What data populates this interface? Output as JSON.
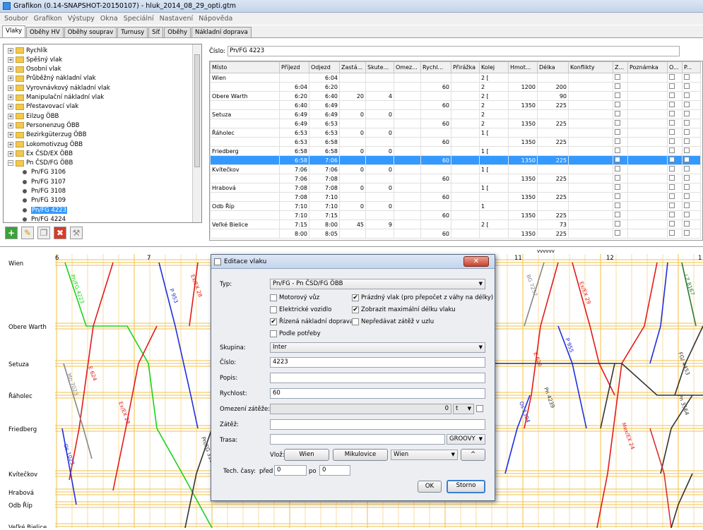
{
  "window": {
    "title": "Grafikon (0.14-SNAPSHOT-20150107) - hluk_2014_08_29_opti.gtm"
  },
  "menu": [
    "Soubor",
    "Grafikon",
    "Výstupy",
    "Okna",
    "Speciální",
    "Nastavení",
    "Nápověda"
  ],
  "tabs": [
    "Vlaky",
    "Oběhy HV",
    "Oběhy souprav",
    "Turnusy",
    "Síť",
    "Oběhy",
    "Nákladní doprava"
  ],
  "tree": {
    "categories": [
      "Rychlík",
      "Spěšný vlak",
      "Osobní vlak",
      "Průběžný nákladní vlak",
      "Vyrovnávkový nákladní vlak",
      "Manipulační nákladní vlak",
      "Přestavovací vlak",
      "Eilzug ÖBB",
      "Personenzug ÖBB",
      "Bezirkgüterzug ÖBB",
      "Lokomotivzug ÖBB",
      "Ex ČSD/EX ÖBB",
      "Pn ČSD/FG ÖBB"
    ],
    "trains": [
      "Pn/FG 3106",
      "Pn/FG 3107",
      "Pn/FG 3108",
      "Pn/FG 3109",
      "Pn/FG 4223",
      "Pn/FG 4224"
    ],
    "expanded": [
      "−",
      "−"
    ],
    "collapsed": "+"
  },
  "toolbar_icons": [
    "add-icon",
    "edit-icon",
    "copy-icon",
    "delete-icon",
    "tools-icon"
  ],
  "train_number": {
    "label": "Číslo:",
    "value": "Pn/FG 4223"
  },
  "route_table": {
    "columns": [
      "Místo",
      "Příjezd",
      "Odjezd",
      "Zastá...",
      "Skute...",
      "Omez...",
      "Rychl...",
      "Přirážka",
      "Kolej",
      "Hmot...",
      "Délka",
      "Konflikty",
      "Z...",
      "Poznámka",
      "O...",
      "P..."
    ],
    "rows": [
      [
        "Wien",
        "",
        "6:04",
        "",
        "",
        "",
        "",
        "",
        "2 [",
        "",
        "",
        "",
        "",
        "",
        "",
        ""
      ],
      [
        "",
        "6:04",
        "6:20",
        "",
        "",
        "",
        "60",
        "",
        "2",
        "1200",
        "200",
        "",
        "",
        "",
        "",
        ""
      ],
      [
        "Obere Warth",
        "6:20",
        "6:40",
        "20",
        "4",
        "",
        "",
        "",
        "2 [",
        "",
        "90",
        "",
        "",
        "",
        "",
        ""
      ],
      [
        "",
        "6:40",
        "6:49",
        "",
        "",
        "",
        "60",
        "",
        "2",
        "1350",
        "225",
        "",
        "",
        "",
        "",
        ""
      ],
      [
        "Setuza",
        "6:49",
        "6:49",
        "0",
        "0",
        "",
        "",
        "",
        "2",
        "",
        "",
        "",
        "",
        "",
        "",
        ""
      ],
      [
        "",
        "6:49",
        "6:53",
        "",
        "",
        "",
        "60",
        "",
        "2",
        "1350",
        "225",
        "",
        "",
        "",
        "",
        ""
      ],
      [
        "Řáholec",
        "6:53",
        "6:53",
        "0",
        "0",
        "",
        "",
        "",
        "1 [",
        "",
        "",
        "",
        "",
        "",
        "",
        ""
      ],
      [
        "",
        "6:53",
        "6:58",
        "",
        "",
        "",
        "60",
        "",
        "",
        "1350",
        "225",
        "",
        "",
        "",
        "",
        ""
      ],
      [
        "Friedberg",
        "6:58",
        "6:58",
        "0",
        "0",
        "",
        "",
        "",
        "1 [",
        "",
        "",
        "",
        "",
        "",
        "",
        ""
      ],
      [
        "",
        "6:58",
        "7:06",
        "",
        "",
        "",
        "60",
        "",
        "",
        "1350",
        "225",
        "",
        "",
        "",
        "",
        ""
      ],
      [
        "Kvítečkov",
        "7:06",
        "7:06",
        "0",
        "0",
        "",
        "",
        "",
        "1 [",
        "",
        "",
        "",
        "",
        "",
        "",
        ""
      ],
      [
        "",
        "7:06",
        "7:08",
        "",
        "",
        "",
        "60",
        "",
        "",
        "1350",
        "225",
        "",
        "",
        "",
        "",
        ""
      ],
      [
        "Hrabová",
        "7:08",
        "7:08",
        "0",
        "0",
        "",
        "",
        "",
        "1 [",
        "",
        "",
        "",
        "",
        "",
        "",
        ""
      ],
      [
        "",
        "7:08",
        "7:10",
        "",
        "",
        "",
        "60",
        "",
        "",
        "1350",
        "225",
        "",
        "",
        "",
        "",
        ""
      ],
      [
        "Odb Říp",
        "7:10",
        "7:10",
        "0",
        "0",
        "",
        "",
        "",
        "1",
        "",
        "",
        "",
        "",
        "",
        "",
        ""
      ],
      [
        "",
        "7:10",
        "7:15",
        "",
        "",
        "",
        "60",
        "",
        "",
        "1350",
        "225",
        "",
        "",
        "",
        "",
        ""
      ],
      [
        "Veľké Bielice",
        "7:15",
        "8:00",
        "45",
        "9",
        "",
        "",
        "",
        "2 [",
        "",
        "73",
        "",
        "",
        "",
        "",
        ""
      ],
      [
        "",
        "8:00",
        "8:05",
        "",
        "",
        "",
        "60",
        "",
        "",
        "1350",
        "225",
        "",
        "",
        "",
        "",
        ""
      ]
    ]
  },
  "graph": {
    "stations": [
      "Wien",
      "Obere Warth",
      "Setuza",
      "Řáholec",
      "Friedberg",
      "Kvítečkov",
      "Hrabová",
      "Odb Říp",
      "Veľké Bielice"
    ],
    "hours": [
      "6",
      "7",
      "11",
      "12",
      "1"
    ],
    "marker": "vvvvvv",
    "train_labels": [
      "Pn/FG 4223",
      "E 624",
      "Ex/EX 28",
      "P 953",
      "Mn 7023",
      "Os 1023",
      "Pn/FG 3106",
      "Os 1304",
      "BG 7252",
      "E 626",
      "Ex/EX 29",
      "Mex/EX 24",
      "P 955",
      "Pn 4239",
      "Pn 4184",
      "Pn 3564",
      "FG/ 4453",
      "LZ 8167"
    ]
  },
  "dialog": {
    "title": "Editace vlaku",
    "typ_label": "Typ:",
    "typ_value": "Pn/FG - Pn ČSD/FG ÖBB",
    "checkboxes_left": [
      {
        "label": "Motorový vůz",
        "checked": false
      },
      {
        "label": "Elektrické vozidlo",
        "checked": false
      },
      {
        "label": "Řízená nákladní doprava",
        "checked": true
      },
      {
        "label": "Podle potřeby",
        "checked": false
      }
    ],
    "checkboxes_right": [
      {
        "label": "Prázdný vlak (pro přepočet z váhy na délky)",
        "checked": true
      },
      {
        "label": "Zobrazit maximální délku vlaku",
        "checked": true
      },
      {
        "label": "Nepředávat zátěž v uzlu",
        "checked": false
      }
    ],
    "skupina_label": "Skupina:",
    "skupina_value": "Inter",
    "cislo_label": "Číslo:",
    "cislo_value": "4223",
    "popis_label": "Popis:",
    "popis_value": "",
    "rychlost_label": "Rychlost:",
    "rychlost_value": "60",
    "omezeni_label": "Omezení zátěže:",
    "omezeni_value": "0",
    "omezeni_unit": "t",
    "zatez_label": "Zátěž:",
    "zatez_value": "",
    "trasa_label": "Trasa:",
    "trasa_value": "",
    "trasa_combo": "GROOVY",
    "vloz_label": "Vlož:",
    "vloz_btn1": "Wien",
    "vloz_btn2": "Mikulovice",
    "vloz_combo": "Wien",
    "vloz_up": "^",
    "tech_label": "Tech. časy:",
    "pred_label": "před",
    "pred_value": "0",
    "po_label": "po",
    "po_value": "0",
    "ok": "OK",
    "storno": "Storno"
  }
}
